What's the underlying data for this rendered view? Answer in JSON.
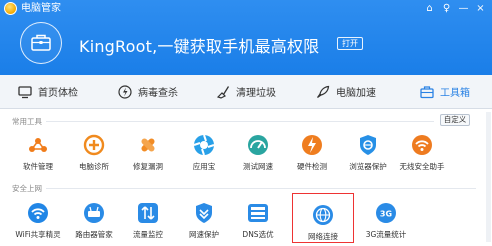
{
  "window": {
    "title": "电脑管家",
    "controls": [
      "⌂",
      "♀",
      "—",
      "×"
    ]
  },
  "header": {
    "headline": "KingRoot,一键获取手机最高权限",
    "open_label": "打开"
  },
  "nav": {
    "items": [
      {
        "label": "首页体检",
        "icon": "monitor-icon"
      },
      {
        "label": "病毒查杀",
        "icon": "shield-lightning-icon"
      },
      {
        "label": "清理垃圾",
        "icon": "broom-icon"
      },
      {
        "label": "电脑加速",
        "icon": "rocket-icon"
      },
      {
        "label": "工具箱",
        "icon": "toolbox-icon",
        "active": true
      }
    ]
  },
  "sections": {
    "common": {
      "title": "常用工具",
      "custom_label": "自定义",
      "tools": [
        {
          "label": "软件管理",
          "icon": "software-manager-icon",
          "color": "#f07c1a"
        },
        {
          "label": "电脑诊所",
          "icon": "clinic-icon",
          "color": "#f08a1e"
        },
        {
          "label": "修复漏洞",
          "icon": "patch-icon",
          "color": "#f28c25"
        },
        {
          "label": "应用宝",
          "icon": "app-store-icon",
          "color": "#28a0e8"
        },
        {
          "label": "测试网速",
          "icon": "speed-test-icon",
          "color": "#2aa5a0"
        },
        {
          "label": "硬件检测",
          "icon": "hardware-icon",
          "color": "#ef7d1f"
        },
        {
          "label": "浏览器保护",
          "icon": "browser-protect-icon",
          "color": "#2790e6"
        },
        {
          "label": "无线安全助手",
          "icon": "wifi-security-icon",
          "color": "#ee7b20"
        }
      ]
    },
    "security": {
      "title": "安全上网",
      "tools": [
        {
          "label": "WiFi共享精灵",
          "icon": "wifi-share-icon",
          "color": "#2186e6"
        },
        {
          "label": "路由器管家",
          "icon": "router-icon",
          "color": "#2a8be6"
        },
        {
          "label": "流量监控",
          "icon": "traffic-monitor-icon",
          "color": "#2a8be6"
        },
        {
          "label": "网速保护",
          "icon": "net-protect-icon",
          "color": "#2a8be6"
        },
        {
          "label": "DNS选优",
          "icon": "dns-icon",
          "color": "#2a8be6"
        },
        {
          "label": "网络连接",
          "icon": "network-connect-icon",
          "color": "#2a8be6",
          "selected": true
        },
        {
          "label": "3G流量统计",
          "icon": "3g-traffic-icon",
          "color": "#2a8be6"
        }
      ]
    }
  }
}
